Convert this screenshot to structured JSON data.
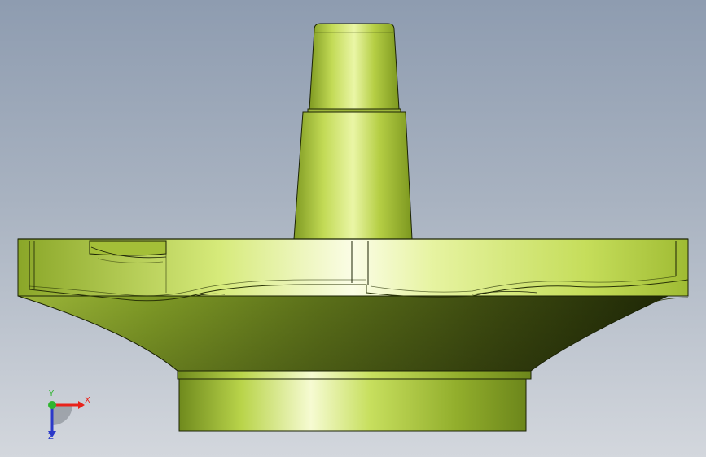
{
  "viewport": {
    "part": "impeller-shaft-part",
    "colors": {
      "background_top": "#8e9cb0",
      "background_bottom": "#d3d7dd",
      "part_light": "#eef7b8",
      "part_mid": "#b9d44a",
      "part_dark": "#3d4a10",
      "edge": "#1b2205"
    }
  },
  "triad": {
    "x_label": "X",
    "y_label": "Y",
    "z_label": "Z",
    "x_color": "#e8231b",
    "y_color": "#2fb52f",
    "z_color": "#2b39c9"
  }
}
